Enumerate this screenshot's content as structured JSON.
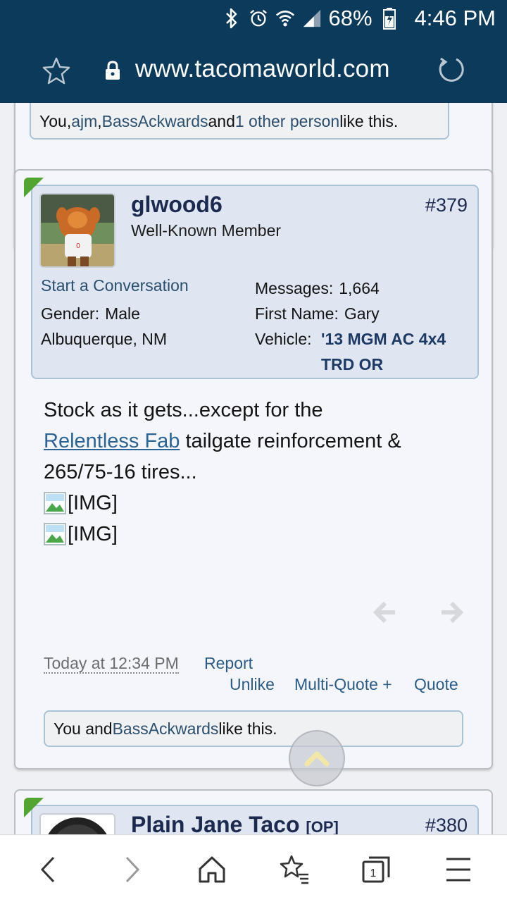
{
  "status_bar": {
    "battery": "68%",
    "time": "4:46 PM",
    "icons": [
      "bluetooth-icon",
      "alarm-icon",
      "wifi-icon",
      "signal-icon",
      "battery-icon"
    ]
  },
  "browser": {
    "url": "www.tacomaworld.com"
  },
  "previous_post": {
    "likes_prefix": "You, ",
    "likes_user1": "ajm",
    "likes_sep": ", ",
    "likes_user2": "BassAckwards",
    "likes_and": " and ",
    "likes_other": "1 other person",
    "likes_suffix": " like this."
  },
  "post": {
    "username": "glwood6",
    "user_title": "Well-Known Member",
    "post_number": "#379",
    "start_conversation": "Start a Conversation",
    "gender_label": "Gender:",
    "gender_value": "Male",
    "location": "Albuquerque, NM",
    "messages_label": "Messages:",
    "messages_value": "1,664",
    "first_name_label": "First Name:",
    "first_name_value": "Gary",
    "vehicle_label": "Vehicle:",
    "vehicle_value_line1": "'13 MGM AC 4x4",
    "vehicle_value_line2": "TRD OR",
    "body_line1": "Stock as it gets...except for the",
    "body_link": "Relentless Fab",
    "body_line2_rest": " tailgate reinforcement &",
    "body_line3": "265/75-16 tires...",
    "img1": "[IMG]",
    "img2": "[IMG]",
    "date": "Today at 12:34 PM",
    "report": "Report",
    "unlike": "Unlike",
    "multi_quote": "Multi-Quote +",
    "quote": "Quote",
    "likes_prefix": "You and ",
    "likes_user": "BassAckwards",
    "likes_suffix": " like this."
  },
  "next_post": {
    "username": "Plain Jane Taco",
    "op_tag": "[OP]",
    "post_number": "#380"
  },
  "colors": {
    "header_bg": "#0c3a5a",
    "link": "#2b4f6e",
    "online_badge": "#53a532"
  }
}
